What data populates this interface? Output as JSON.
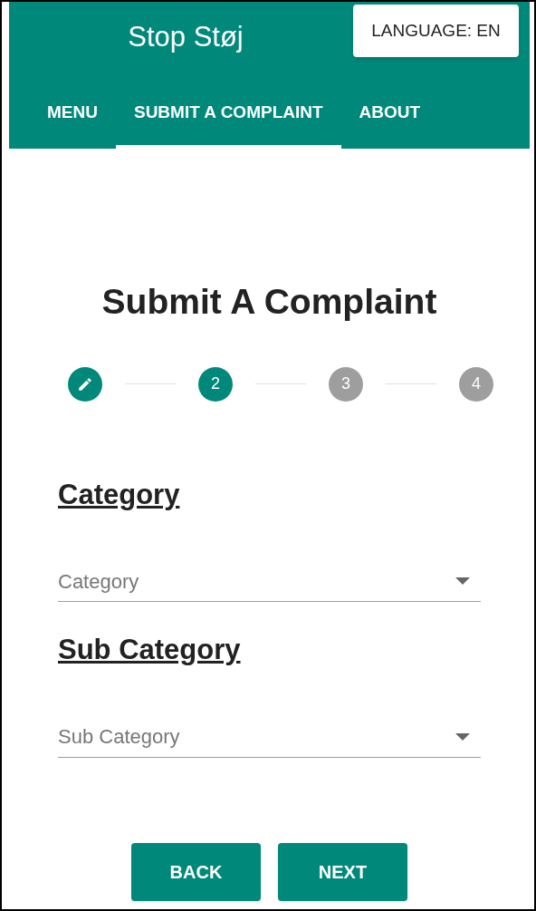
{
  "app_bar": {
    "title": "Stop Støj",
    "language_button": "LANGUAGE: EN"
  },
  "tabs": [
    {
      "label": "MENU",
      "selected": false
    },
    {
      "label": "SUBMIT A COMPLAINT",
      "selected": true
    },
    {
      "label": "ABOUT",
      "selected": false
    }
  ],
  "heading": "Submit A Complaint",
  "steps": [
    {
      "kind": "edit",
      "active": true
    },
    {
      "kind": "number",
      "label": "2",
      "active": true
    },
    {
      "kind": "number",
      "label": "3",
      "active": false
    },
    {
      "kind": "number",
      "label": "4",
      "active": false
    }
  ],
  "fields": [
    {
      "heading": "Category",
      "placeholder": "Category"
    },
    {
      "heading": "Sub Category",
      "placeholder": "Sub Category"
    }
  ],
  "buttons": [
    "BACK",
    "NEXT"
  ]
}
